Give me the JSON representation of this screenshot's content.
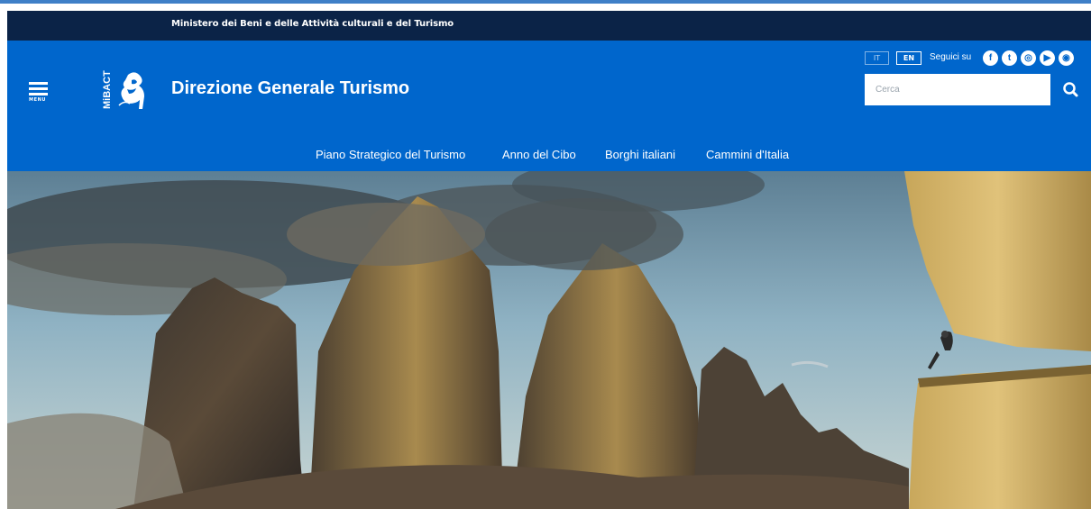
{
  "ministry": {
    "name": "Ministero dei Beni e delle Attività culturali e del Turismo"
  },
  "header": {
    "menu_label": "MENU",
    "logo_text": "MiBACT",
    "site_title": "Direzione Generale Turismo",
    "lang": {
      "it": "IT",
      "en": "EN",
      "active": "EN"
    },
    "follow_label": "Seguici su",
    "social": [
      {
        "name": "facebook-icon",
        "glyph": "f"
      },
      {
        "name": "twitter-icon",
        "glyph": "t"
      },
      {
        "name": "instagram-icon",
        "glyph": "◎"
      },
      {
        "name": "youtube-icon",
        "glyph": "▶"
      },
      {
        "name": "other-social-icon",
        "glyph": "◉"
      }
    ],
    "search": {
      "placeholder": "Cerca"
    }
  },
  "nav": {
    "items": [
      {
        "label": "Piano Strategico del Turismo"
      },
      {
        "label": "Anno del Cibo"
      },
      {
        "label": "Borghi italiani"
      },
      {
        "label": "Cammini d'Italia"
      }
    ]
  },
  "colors": {
    "ministry_bar": "#0b2347",
    "header_blue": "#0066cc",
    "top_accent": "#3f7fc7"
  }
}
